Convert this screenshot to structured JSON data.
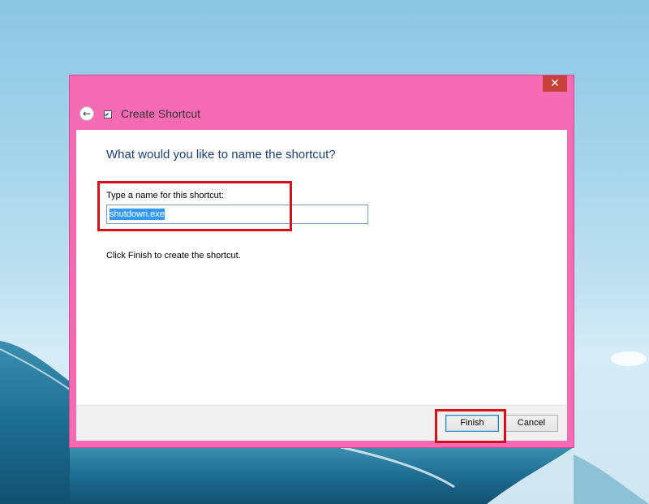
{
  "window": {
    "title": "Create Shortcut",
    "close_glyph": "✕",
    "back_glyph": "←"
  },
  "page": {
    "heading": "What would you like to name the shortcut?",
    "field_label": "Type a name for this shortcut:",
    "name_value": "shutdown.exe",
    "hint": "Click Finish to create the shortcut."
  },
  "buttons": {
    "finish": "Finish",
    "cancel": "Cancel"
  },
  "colors": {
    "titlebar": "#f46bb4",
    "close": "#c7403a",
    "annotation": "#d7111b",
    "selection": "#3399ff"
  },
  "icons": {
    "back": "back-arrow-icon",
    "app": "shortcut-icon",
    "close": "close-icon"
  }
}
